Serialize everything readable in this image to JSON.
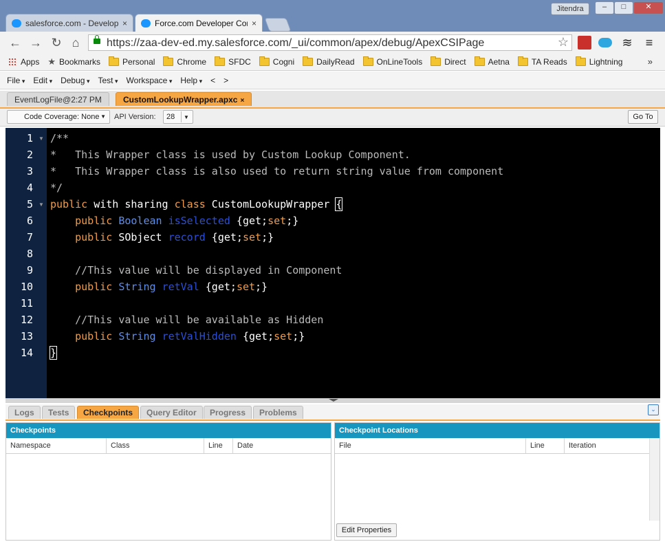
{
  "browser": {
    "user": "Jitendra",
    "tabs": [
      {
        "label": "salesforce.com - Develope"
      },
      {
        "label": "Force.com Developer Con"
      }
    ],
    "close_glyph": "×",
    "url": "https://zaa-dev-ed.my.salesforce.com/_ui/common/apex/debug/ApexCSIPage",
    "bookmarks": [
      "Apps",
      "Bookmarks",
      "Personal",
      "Chrome",
      "SFDC",
      "Cogni",
      "DailyRead",
      "OnLineTools",
      "Direct",
      "Aetna",
      "TA Reads",
      "Lightning"
    ],
    "more": "»",
    "window_buttons": {
      "minimize": "–",
      "maximize": "□",
      "close": "✕"
    }
  },
  "console": {
    "menu": [
      "File",
      "Edit",
      "Debug",
      "Test",
      "Workspace",
      "Help"
    ],
    "nav_back": "<",
    "nav_forward": ">",
    "file_tabs": [
      {
        "label": "EventLogFile@2:27 PM"
      },
      {
        "label": "CustomLookupWrapper.apxc"
      }
    ],
    "code_coverage": "Code Coverage: None",
    "api_label": "API Version:",
    "api_version": "28",
    "goto": "Go To"
  },
  "editor": {
    "line_numbers": [
      "1",
      "2",
      "3",
      "4",
      "5",
      "6",
      "7",
      "8",
      "9",
      "10",
      "11",
      "12",
      "13",
      "14"
    ],
    "lines": [
      [
        {
          "t": "/**",
          "c": "com"
        }
      ],
      [
        {
          "t": "*   This Wrapper class is used by Custom Lookup Component.",
          "c": "com"
        }
      ],
      [
        {
          "t": "*   This Wrapper class is also used to return string value from component",
          "c": "com"
        }
      ],
      [
        {
          "t": "*/",
          "c": "com"
        }
      ],
      [
        {
          "t": "public",
          "c": "kw"
        },
        {
          "t": " with sharing ",
          "c": "pl"
        },
        {
          "t": "class",
          "c": "kw"
        },
        {
          "t": " CustomLookupWrapper ",
          "c": "pl"
        },
        {
          "t": "{",
          "c": "pl"
        }
      ],
      [
        {
          "t": "    public",
          "c": "kw"
        },
        {
          "t": " ",
          "c": "pl"
        },
        {
          "t": "Boolean",
          "c": "ty"
        },
        {
          "t": " ",
          "c": "pl"
        },
        {
          "t": "isSelected",
          "c": "id"
        },
        {
          "t": " {get;",
          "c": "pl"
        },
        {
          "t": "set",
          "c": "kw"
        },
        {
          "t": ";}",
          "c": "pl"
        }
      ],
      [
        {
          "t": "    public",
          "c": "kw"
        },
        {
          "t": " SObject ",
          "c": "pl"
        },
        {
          "t": "record",
          "c": "id"
        },
        {
          "t": " {get;",
          "c": "pl"
        },
        {
          "t": "set",
          "c": "kw"
        },
        {
          "t": ";}",
          "c": "pl"
        }
      ],
      [
        {
          "t": "",
          "c": "pl"
        }
      ],
      [
        {
          "t": "    //This value will be displayed in Component",
          "c": "com"
        }
      ],
      [
        {
          "t": "    public",
          "c": "kw"
        },
        {
          "t": " ",
          "c": "pl"
        },
        {
          "t": "String",
          "c": "ty"
        },
        {
          "t": " ",
          "c": "pl"
        },
        {
          "t": "retVal",
          "c": "id"
        },
        {
          "t": " {get;",
          "c": "pl"
        },
        {
          "t": "set",
          "c": "kw"
        },
        {
          "t": ";}",
          "c": "pl"
        }
      ],
      [
        {
          "t": "",
          "c": "pl"
        }
      ],
      [
        {
          "t": "    //This value will be available as Hidden",
          "c": "com"
        }
      ],
      [
        {
          "t": "    public",
          "c": "kw"
        },
        {
          "t": " ",
          "c": "pl"
        },
        {
          "t": "String",
          "c": "ty"
        },
        {
          "t": " ",
          "c": "pl"
        },
        {
          "t": "retValHidden",
          "c": "id"
        },
        {
          "t": " {get;",
          "c": "pl"
        },
        {
          "t": "set",
          "c": "kw"
        },
        {
          "t": ";}",
          "c": "pl"
        }
      ],
      [
        {
          "t": "}",
          "c": "pl"
        }
      ]
    ]
  },
  "bottom": {
    "tabs": [
      "Logs",
      "Tests",
      "Checkpoints",
      "Query Editor",
      "Progress",
      "Problems"
    ],
    "active_tab": "Checkpoints",
    "checkpoints": {
      "title": "Checkpoints",
      "columns": [
        "Namespace",
        "Class",
        "Line",
        "Date"
      ]
    },
    "locations": {
      "title": "Checkpoint Locations",
      "columns": [
        "File",
        "Line",
        "Iteration"
      ],
      "edit_button": "Edit Properties"
    }
  },
  "colors": {
    "accent_orange": "#f6a743",
    "panel_header": "#1797c0",
    "editor_bg": "#000000",
    "gutter_bg": "#0f2340"
  }
}
